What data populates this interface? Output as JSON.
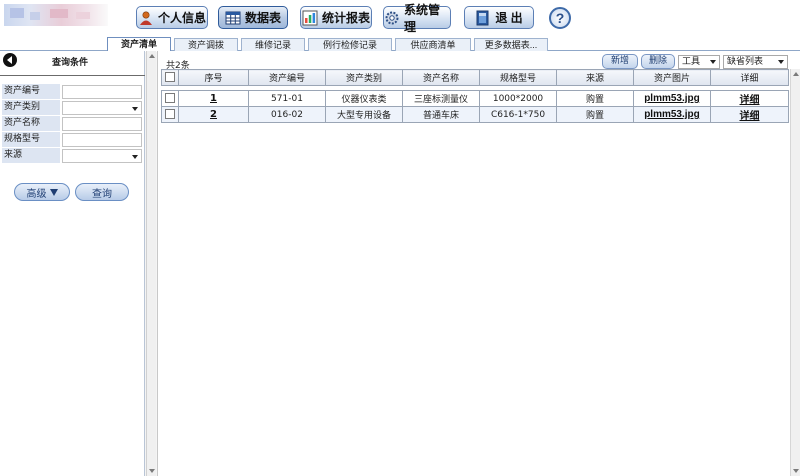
{
  "toolbar": {
    "buttons": [
      {
        "label": "个人信息",
        "icon": "person-icon"
      },
      {
        "label": "数据表",
        "icon": "table-icon"
      },
      {
        "label": "统计报表",
        "icon": "chart-icon"
      },
      {
        "label": "系统管理",
        "icon": "gear-icon"
      },
      {
        "label": "退 出",
        "icon": "exit-icon"
      }
    ],
    "help": "?"
  },
  "tabs": [
    "资产清单",
    "资产调拨",
    "维修记录",
    "例行检修记录",
    "供应商清单",
    "更多数据表..."
  ],
  "active_tab": "资产清单",
  "left_panel": {
    "title": "查询条件",
    "fields": [
      {
        "label": "资产编号",
        "type": "input",
        "value": ""
      },
      {
        "label": "资产类别",
        "type": "select",
        "value": ""
      },
      {
        "label": "资产名称",
        "type": "input",
        "value": ""
      },
      {
        "label": "规格型号",
        "type": "input",
        "value": ""
      },
      {
        "label": "来源",
        "type": "select",
        "value": ""
      }
    ],
    "advanced_label": "高级",
    "query_label": "查询"
  },
  "main": {
    "count_text": "共2条",
    "add_label": "新增",
    "delete_label": "删除",
    "tools_select": "工具",
    "view_select": "缺省列表"
  },
  "table": {
    "columns": [
      "序号",
      "资产编号",
      "资产类别",
      "资产名称",
      "规格型号",
      "来源",
      "资产图片",
      "详细"
    ],
    "rows": [
      {
        "seq": "1",
        "code": "571-01",
        "category": "仪器仪表类",
        "name": "三座标测量仪",
        "spec": "1000*2000",
        "source": "购置",
        "image": "plmm53.jpg",
        "detail": "详细"
      },
      {
        "seq": "2",
        "code": "016-02",
        "category": "大型专用设备",
        "name": "普通车床",
        "spec": "C616-1*750",
        "source": "购置",
        "image": "plmm53.jpg",
        "detail": "详细"
      }
    ]
  },
  "colors": {
    "accent": "#5c7fb5",
    "header_bg": "#dfe5ef",
    "label_bg": "#dde5f2",
    "alt_row": "#eef3fb"
  }
}
